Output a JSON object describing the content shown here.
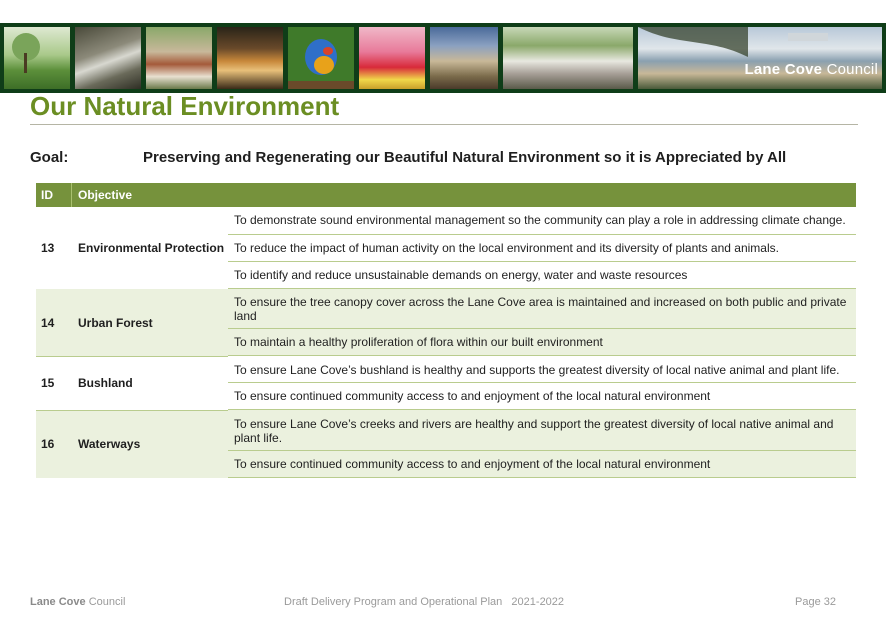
{
  "banner": {
    "brand_strong": "Lane Cove",
    "brand_rest": " Council"
  },
  "title": "Our Natural Environment",
  "goal": {
    "label": "Goal:",
    "text": "Preserving and Regenerating our Beautiful Natural Environment so it is Appreciated by All"
  },
  "table": {
    "headers": {
      "id": "ID",
      "objective": "Objective"
    },
    "groups": [
      {
        "id": "13",
        "name": "Environmental Protection",
        "objectives": [
          "To demonstrate sound environmental management so the community can play a role in addressing climate change.",
          "To reduce the impact of human activity on the local environment and its diversity of plants and animals.",
          "To identify and reduce unsustainable demands on energy, water and waste resources"
        ]
      },
      {
        "id": "14",
        "name": "Urban Forest",
        "objectives": [
          "To ensure the tree canopy cover across the Lane Cove area is maintained and increased on both public and private land",
          "To maintain a healthy proliferation of flora within our built environment"
        ]
      },
      {
        "id": "15",
        "name": "Bushland",
        "objectives": [
          "To ensure Lane Cove’s bushland is healthy and supports the greatest diversity of local native animal and plant life.",
          "To ensure continued community access to and enjoyment of the local natural environment"
        ]
      },
      {
        "id": "16",
        "name": "Waterways",
        "objectives": [
          "To ensure Lane Cove’s creeks and rivers are healthy and support the greatest diversity of local native animal and plant life.",
          "To ensure continued community access to and enjoyment of the local natural environment"
        ]
      }
    ]
  },
  "footer": {
    "council_strong": "Lane Cove",
    "council_rest": " Council",
    "document": "Draft Delivery Program and Operational Plan   2021-2022",
    "page": "Page 32"
  }
}
